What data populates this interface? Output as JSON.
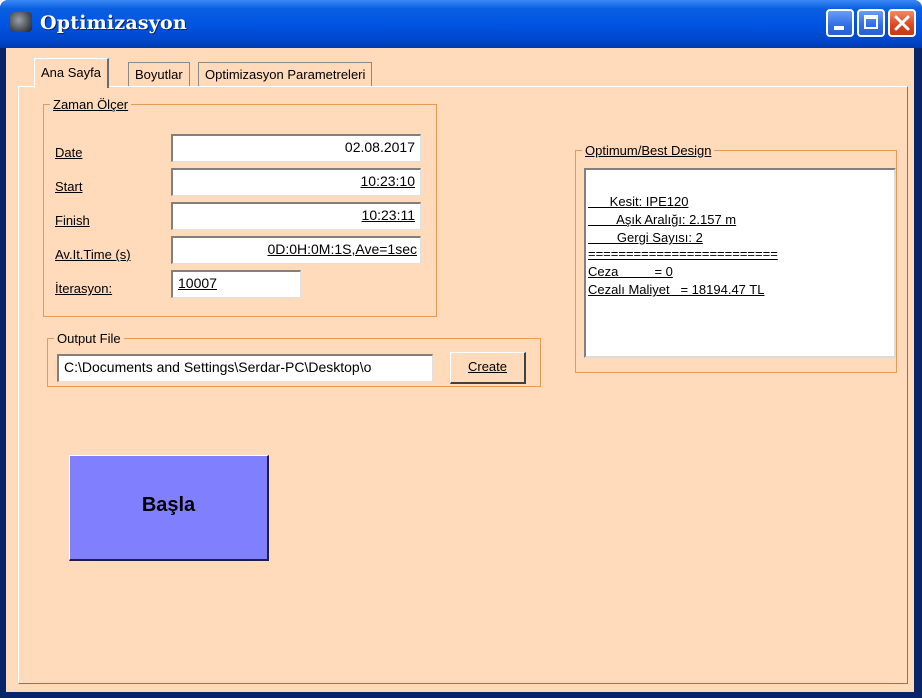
{
  "window": {
    "title": "Optimizasyon"
  },
  "tabs": [
    {
      "label": "Ana Sayfa",
      "active": true
    },
    {
      "label": "Boyutlar",
      "active": false
    },
    {
      "label": "Optimizasyon Parametreleri",
      "active": false
    }
  ],
  "zaman": {
    "legend": "Zaman Ölçer",
    "date_label": "Date",
    "date_value": "02.08.2017",
    "start_label": "Start",
    "start_value": "10:23:10",
    "finish_label": "Finish",
    "finish_value": "10:23:11",
    "avtime_label": "Av.It.Time (s)",
    "avtime_value": "0D:0H:0M:1S,Ave=1sec",
    "iter_label": "İterasyon:",
    "iter_value": "10007"
  },
  "output": {
    "legend": "Output File",
    "path": "C:\\Documents and Settings\\Serdar-PC\\Desktop\\o",
    "create_label": "Create"
  },
  "basla_label": "Başla",
  "optimum": {
    "legend": "Optimum/Best Design",
    "lines": [
      "      Kesit: IPE120",
      "        Aşık Aralığı: 2.157 m",
      "        Gergi Sayısı: 2",
      "=========================",
      "Ceza          = 0",
      "Cezalı Maliyet   = 18194.47 TL"
    ]
  },
  "colors": {
    "client_bg": "#ffdabb",
    "basla_bg": "#8080ff",
    "titlebar": "#0054e3",
    "group_border": "#e59a55"
  }
}
